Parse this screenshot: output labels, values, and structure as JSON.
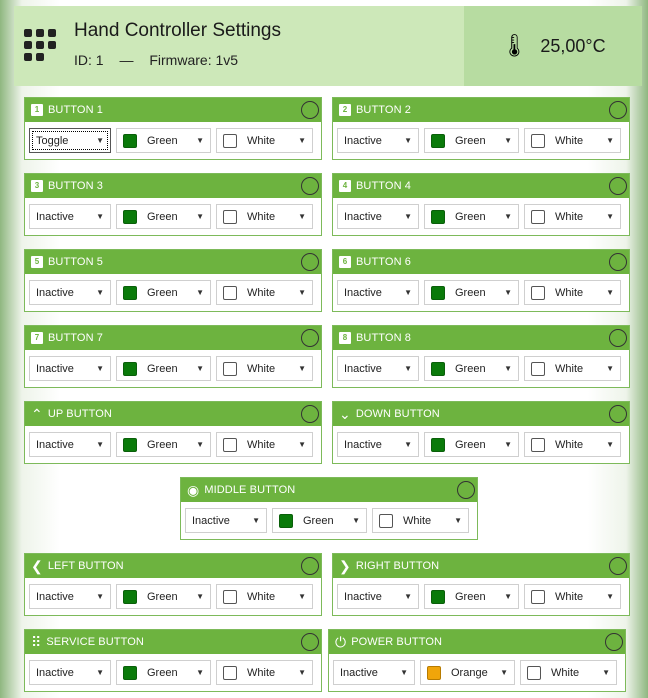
{
  "header": {
    "title": "Hand Controller Settings",
    "id_label": "ID:",
    "id_value": "1",
    "separator": "—",
    "firmware_label": "Firmware:",
    "firmware_value": "1v5",
    "temperature": "25,00°C"
  },
  "colors": {
    "accent": "#6db33f",
    "header_bg": "#cde8b9",
    "green_swatch": "#0a7a0a",
    "orange_swatch": "#f0a50a"
  },
  "panels": [
    {
      "name": "BUTTON 1",
      "icon": "1",
      "mode": "Toggle",
      "led1": "Green",
      "led2": "White"
    },
    {
      "name": "BUTTON 2",
      "icon": "2",
      "mode": "Inactive",
      "led1": "Green",
      "led2": "White"
    },
    {
      "name": "BUTTON 3",
      "icon": "3",
      "mode": "Inactive",
      "led1": "Green",
      "led2": "White"
    },
    {
      "name": "BUTTON 4",
      "icon": "4",
      "mode": "Inactive",
      "led1": "Green",
      "led2": "White"
    },
    {
      "name": "BUTTON 5",
      "icon": "5",
      "mode": "Inactive",
      "led1": "Green",
      "led2": "White"
    },
    {
      "name": "BUTTON 6",
      "icon": "6",
      "mode": "Inactive",
      "led1": "Green",
      "led2": "White"
    },
    {
      "name": "BUTTON 7",
      "icon": "7",
      "mode": "Inactive",
      "led1": "Green",
      "led2": "White"
    },
    {
      "name": "BUTTON 8",
      "icon": "8",
      "mode": "Inactive",
      "led1": "Green",
      "led2": "White"
    },
    {
      "name": "UP BUTTON",
      "icon": "up-arrow",
      "mode": "Inactive",
      "led1": "Green",
      "led2": "White"
    },
    {
      "name": "DOWN BUTTON",
      "icon": "down-arrow",
      "mode": "Inactive",
      "led1": "Green",
      "led2": "White"
    },
    {
      "name": "MIDDLE BUTTON",
      "icon": "radio-dot",
      "mode": "Inactive",
      "led1": "Green",
      "led2": "White"
    },
    {
      "name": "LEFT BUTTON",
      "icon": "left-arrow",
      "mode": "Inactive",
      "led1": "Green",
      "led2": "White"
    },
    {
      "name": "RIGHT BUTTON",
      "icon": "right-arrow",
      "mode": "Inactive",
      "led1": "Green",
      "led2": "White"
    },
    {
      "name": "SERVICE BUTTON",
      "icon": "keypad",
      "mode": "Inactive",
      "led1": "Green",
      "led2": "White"
    },
    {
      "name": "POWER BUTTON",
      "icon": "power",
      "mode": "Inactive",
      "led1": "Orange",
      "led2": "White"
    }
  ]
}
